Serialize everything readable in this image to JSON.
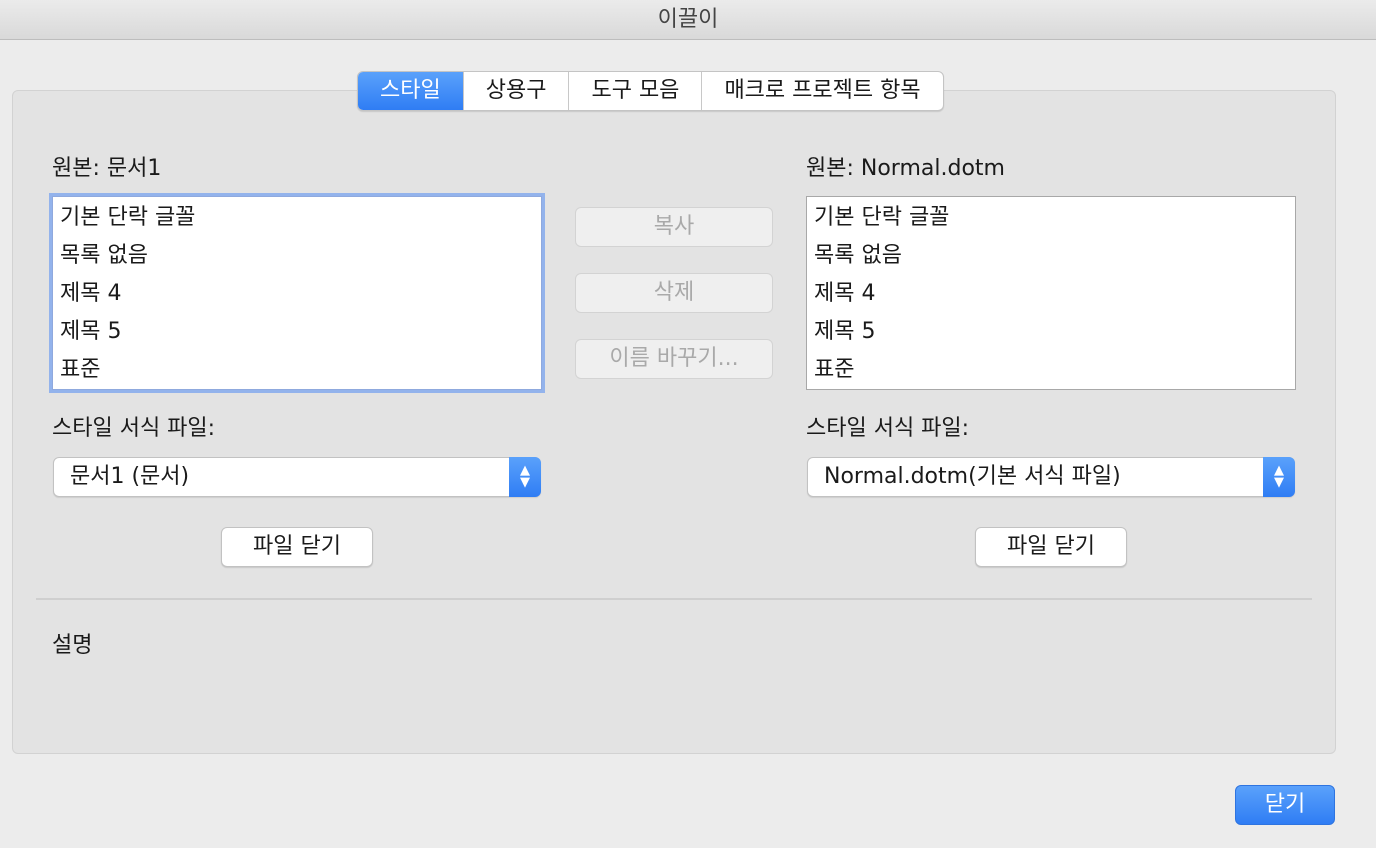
{
  "window": {
    "title": "이끌이"
  },
  "tabs": [
    {
      "label": "스타일",
      "active": true
    },
    {
      "label": "상용구",
      "active": false
    },
    {
      "label": "도구 모음",
      "active": false
    },
    {
      "label": "매크로 프로젝트 항목",
      "active": false
    }
  ],
  "left": {
    "source_label": "원본: 문서1",
    "items": [
      "기본 단락 글꼴",
      "목록 없음",
      "제목 4",
      "제목 5",
      "표준"
    ],
    "template_label": "스타일 서식 파일:",
    "template_value": "문서1 (문서)",
    "close_file_label": "파일 닫기"
  },
  "right": {
    "source_label": "원본: Normal.dotm",
    "items": [
      "기본 단락 글꼴",
      "목록 없음",
      "제목 4",
      "제목 5",
      "표준"
    ],
    "template_label": "스타일 서식 파일:",
    "template_value": "Normal.dotm(기본 서식 파일)",
    "close_file_label": "파일 닫기"
  },
  "actions": {
    "copy_label": "복사",
    "delete_label": "삭제",
    "rename_label": "이름 바꾸기..."
  },
  "description": {
    "label": "설명"
  },
  "footer": {
    "close_label": "닫기"
  },
  "colors": {
    "accent": "#2f7df4",
    "disabled_text": "#a9a9a9",
    "focus_ring": "#93b3ec"
  }
}
